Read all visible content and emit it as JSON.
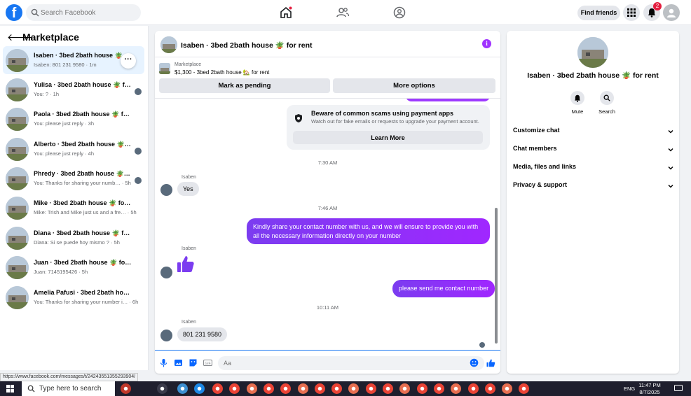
{
  "header": {
    "logo": "f",
    "search_placeholder": "Search Facebook",
    "find_friends": "Find friends",
    "notification_count": "2"
  },
  "sidebar": {
    "title": "Marketplace",
    "chats": [
      {
        "name": "Isaben · 3bed 2bath house 🪴 f…",
        "preview": "Isaben: 801 231 9580 · 1m"
      },
      {
        "name": "Yulisa · 3bed 2bath house 🪴 for…",
        "preview": "You: ? · 1h"
      },
      {
        "name": "Paola · 3bed 2bath house 🪴 for re…",
        "preview": "You: please just reply · 3h"
      },
      {
        "name": "Alberto · 3bed 2bath house 🪴 f…",
        "preview": "You: please just reply · 4h"
      },
      {
        "name": "Phredy · 3bed 2bath house 🪴 f…",
        "preview": "You: Thanks for sharing your numb… · 5h"
      },
      {
        "name": "Mike · 3bed 2bath house 🪴 for rent",
        "preview": "Mike: Trish and Mike just us and a fre… · 5h"
      },
      {
        "name": "Diana · 3bed 2bath house 🪴 for r…",
        "preview": "Diana: Si se puede hoy mismo ? · 5h"
      },
      {
        "name": "Juan · 3bed 2bath house 🪴 for rent",
        "preview": "Juan: 7145195426 · 5h"
      },
      {
        "name": "Amelia Pafusi · 3bed 2bath house …",
        "preview": "You: Thanks for sharing your number i… · 6h"
      }
    ],
    "more_label": "···"
  },
  "chat": {
    "title": "Isaben · 3bed 2bath house 🪴 for rent",
    "info_icon": "i",
    "listing_label": "Marketplace",
    "listing_detail": "$1,300 - 3bed 2bath house 🏡 for rent",
    "mark_pending": "Mark as pending",
    "more_options": "More options",
    "scam_title": "Beware of common scams using payment apps",
    "scam_sub": "Watch out for fake emails or requests to upgrade your payment account.",
    "learn_more": "Learn More",
    "time1": "7:30 AM",
    "sender": "Isaben",
    "msg_yes": "Yes",
    "time2": "7:46 AM",
    "msg_out1": "Kindly share your contact number with us, and we will ensure to provide you with all the necessary information directly on your number",
    "msg_like": "👍",
    "msg_out2": "please send me contact number",
    "time3": "10:11 AM",
    "msg_phone": "801 231 9580",
    "composer_placeholder": "Aa"
  },
  "details": {
    "title": "Isaben · 3bed 2bath house 🪴 for rent",
    "mute": "Mute",
    "search": "Search",
    "rows": [
      "Customize chat",
      "Chat members",
      "Media, files and links",
      "Privacy & support"
    ]
  },
  "status_url": "https://www.facebook.com/messages/t/24243551355293904/",
  "taskbar": {
    "search_placeholder": "Type here to search",
    "lang": "ENG",
    "time": "11:47 PM",
    "date": "8/7/2025"
  },
  "colors": {
    "brand": "#1877f2",
    "accent": "#a033ff",
    "badge": "#e41e3f"
  }
}
